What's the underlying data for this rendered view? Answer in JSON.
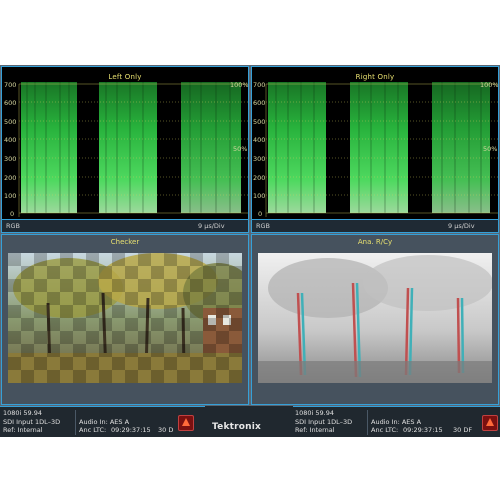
{
  "waveform_left": {
    "title": "Left Only",
    "ticks": [
      "700",
      "600",
      "500",
      "400",
      "300",
      "200",
      "100",
      "0"
    ],
    "pct_top": "100%",
    "pct_mid": "50%",
    "mode": "RGB",
    "time_div": "9 µs/Div"
  },
  "waveform_right": {
    "title": "Right Only",
    "ticks": [
      "700",
      "600",
      "500",
      "400",
      "300",
      "200",
      "100",
      "0"
    ],
    "pct_top": "100%",
    "pct_mid": "50%",
    "mode": "RGB",
    "time_div": "9 µs/Div"
  },
  "picture_left": {
    "title": "Checker"
  },
  "picture_right": {
    "title": "Ana. R/Cy"
  },
  "status_left": {
    "format": "1080i 59.94",
    "input": "SDI Input 1DL–3D",
    "ref": "Ref: Internal",
    "audio": "Audio In: AES A",
    "ltc_label": "Anc LTC:",
    "ltc_time": "09:29:37:15",
    "ltc_rate": "30 D"
  },
  "status_right": {
    "format": "1080i 59.94",
    "input": "SDI Input 1DL–3D",
    "ref": "Ref: Internal",
    "audio": "Audio In: AES A",
    "ltc_label": "Anc LTC:",
    "ltc_time": "09:29:37:15",
    "ltc_rate": "30 DF"
  },
  "brand": "Tektronix",
  "colors": {
    "trace": "#3cff5a",
    "graticule": "#d8d060",
    "panel_border": "#35a0d8",
    "title": "#e8e070"
  }
}
